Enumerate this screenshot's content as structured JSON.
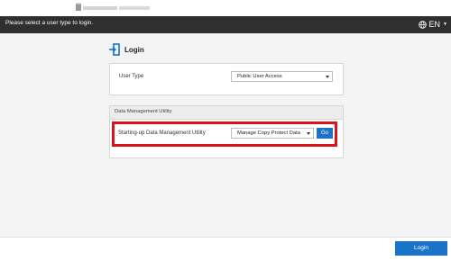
{
  "header": {
    "message": "Please select a user type to login.",
    "language": "EN"
  },
  "login": {
    "title": "Login"
  },
  "user_type": {
    "label": "User Type",
    "selected": "Public User Access"
  },
  "data_management": {
    "section_title": "Data Management Utility",
    "row_label": "Starting-up Data Management Utility",
    "selected": "Manage Copy Protect Data",
    "go_label": "Go"
  },
  "footer": {
    "login_button": "Login"
  },
  "colors": {
    "header_bg": "#2f2f2f",
    "accent_blue": "#1a73c6",
    "highlight_red": "#d9121b"
  }
}
